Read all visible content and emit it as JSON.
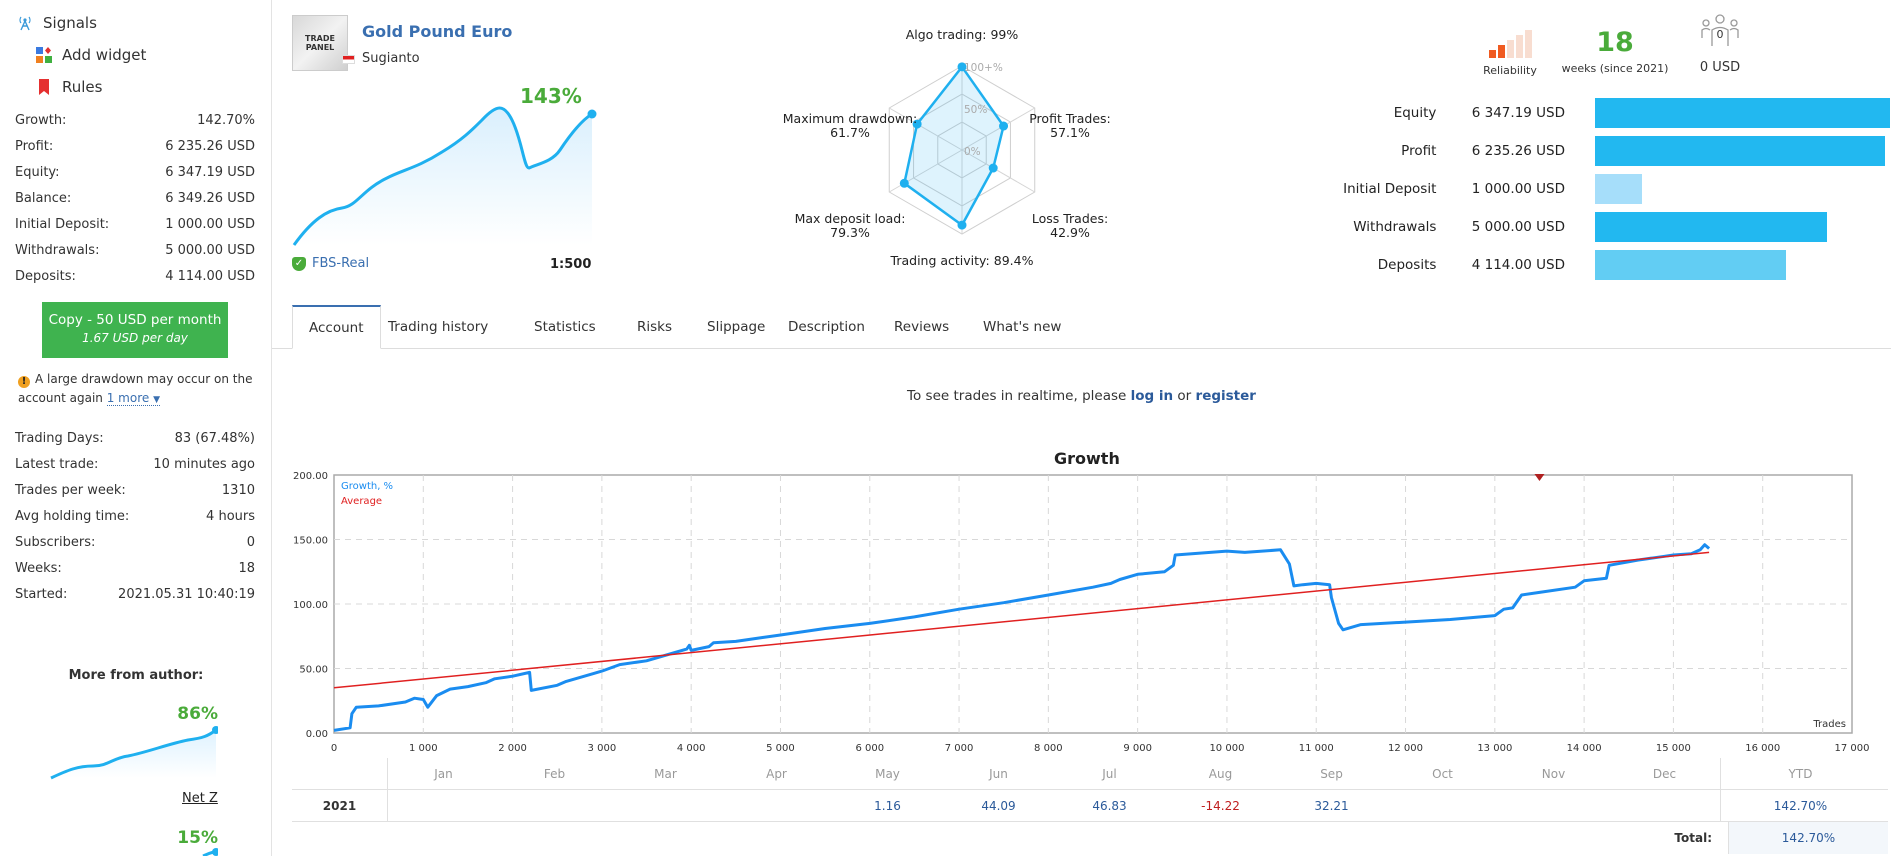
{
  "sidebar": {
    "nav": [
      {
        "label": "Signals",
        "icon": "antenna-icon"
      },
      {
        "label": "Add widget",
        "icon": "widget-icon"
      },
      {
        "label": "Rules",
        "icon": "bookmark-icon"
      }
    ],
    "stats": [
      {
        "label": "Growth:",
        "value": "142.70%"
      },
      {
        "label": "Profit:",
        "value": "6 235.26 USD"
      },
      {
        "label": "Equity:",
        "value": "6 347.19 USD"
      },
      {
        "label": "Balance:",
        "value": "6 349.26 USD"
      },
      {
        "label": "Initial Deposit:",
        "value": "1 000.00 USD"
      },
      {
        "label": "Withdrawals:",
        "value": "5 000.00 USD"
      },
      {
        "label": "Deposits:",
        "value": "4 114.00 USD"
      }
    ],
    "copy_button": {
      "line1": "Copy - 50 USD per month",
      "line2": "1.67 USD per day"
    },
    "warning": {
      "text": "A large drawdown may occur on the account again",
      "more": "1 more"
    },
    "stats2": [
      {
        "label": "Trading Days:",
        "value": "83 (67.48%)"
      },
      {
        "label": "Latest trade:",
        "value": "10 minutes ago"
      },
      {
        "label": "Trades per week:",
        "value": "1310"
      },
      {
        "label": "Avg holding time:",
        "value": "4 hours"
      },
      {
        "label": "Subscribers:",
        "value": "0"
      },
      {
        "label": "Weeks:",
        "value": "18"
      },
      {
        "label": "Started:",
        "value": "2021.05.31 10:40:19"
      }
    ],
    "more_from_author": "More from author:",
    "author_signals": [
      {
        "growth": "86%",
        "name": "Net Z"
      },
      {
        "growth": "15%",
        "name": ""
      }
    ]
  },
  "header": {
    "logo_text": "TRADE PANEL",
    "title": "Gold Pound Euro",
    "author": "Sugianto",
    "growth_pct": "143%",
    "broker": "FBS-Real",
    "leverage": "1:500"
  },
  "radar": {
    "scale_labels": [
      "100+%",
      "50%",
      "0%"
    ],
    "axes": [
      {
        "label": "Algo trading:",
        "value": "99%",
        "v": 99
      },
      {
        "label": "Profit Trades:",
        "value": "57.1%",
        "v": 57.1
      },
      {
        "label": "Loss Trades:",
        "value": "42.9%",
        "v": 42.9
      },
      {
        "label": "Trading activity:",
        "value": "89.4%",
        "v": 89.4
      },
      {
        "label": "Max deposit load:",
        "value": "79.3%",
        "v": 79.3
      },
      {
        "label": "Maximum drawdown:",
        "value": "61.7%",
        "v": 61.7
      }
    ]
  },
  "summary": {
    "reliability_label": "Reliability",
    "reliability_level": 2,
    "reliability_max": 5,
    "weeks": "18",
    "weeks_label": "weeks (since 2021)",
    "subscribers_count": "0",
    "subscribers_value": "0 USD"
  },
  "balance_bars": [
    {
      "label": "Equity",
      "value": "6 347.19 USD",
      "amount": 6347.19,
      "color": "#22b8f0"
    },
    {
      "label": "Profit",
      "value": "6 235.26 USD",
      "amount": 6235.26,
      "color": "#22b8f0"
    },
    {
      "label": "Initial Deposit",
      "value": "1 000.00 USD",
      "amount": 1000.0,
      "color": "#a6defa"
    },
    {
      "label": "Withdrawals",
      "value": "5 000.00 USD",
      "amount": 5000.0,
      "color": "#22b8f0"
    },
    {
      "label": "Deposits",
      "value": "4 114.00 USD",
      "amount": 4114.0,
      "color": "#62cdf3"
    }
  ],
  "tabs": [
    "Account",
    "Trading history",
    "Statistics",
    "Risks",
    "Slippage",
    "Description",
    "Reviews",
    "What's new"
  ],
  "active_tab": 0,
  "realtime": {
    "prefix": "To see trades in realtime, please ",
    "login": "log in",
    "or": " or ",
    "register": "register"
  },
  "chart_data": {
    "type": "line",
    "title": "Growth",
    "xlabel": "Trades",
    "ylabel": "",
    "xlim": [
      0,
      17000
    ],
    "ylim": [
      0,
      200
    ],
    "x_ticks": [
      "0",
      "1 000",
      "2 000",
      "3 000",
      "4 000",
      "5 000",
      "6 000",
      "7 000",
      "8 000",
      "9 000",
      "10 000",
      "11 000",
      "12 000",
      "13 000",
      "14 000",
      "15 000",
      "16 000",
      "17 000"
    ],
    "y_ticks": [
      "0.00",
      "50.00",
      "100.00",
      "150.00",
      "200.00"
    ],
    "grid": true,
    "legend": "top-left",
    "series": [
      {
        "name": "Growth, %",
        "color": "#1a8cf0",
        "x": [
          0,
          180,
          200,
          250,
          500,
          800,
          900,
          1000,
          1050,
          1150,
          1300,
          1500,
          1700,
          1800,
          2000,
          2190,
          2210,
          2500,
          2600,
          2900,
          3000,
          3200,
          3500,
          3800,
          3950,
          3980,
          4000,
          4200,
          4250,
          4500,
          4800,
          5000,
          5500,
          6000,
          6500,
          7000,
          7500,
          8000,
          8500,
          8700,
          8800,
          9000,
          9300,
          9400,
          9420,
          10000,
          10200,
          10600,
          10700,
          10750,
          10850,
          11000,
          11150,
          11170,
          11250,
          11300,
          11500,
          12000,
          12500,
          13000,
          13100,
          13200,
          13300,
          13500,
          13900,
          14000,
          14250,
          14280,
          14600,
          14900,
          15000,
          15200,
          15300,
          15350,
          15400
        ],
        "y": [
          2,
          4,
          15,
          20,
          21,
          24,
          27,
          26,
          20,
          29,
          34,
          36,
          39,
          42,
          44,
          47,
          33,
          37,
          40,
          46,
          48,
          53,
          56,
          62,
          65,
          68,
          64,
          67,
          70,
          71,
          74,
          76,
          81,
          85,
          90,
          96,
          101,
          107,
          113,
          116,
          119,
          123,
          125,
          130,
          138,
          141,
          140,
          142,
          131,
          114,
          115,
          116,
          115,
          105,
          85,
          80,
          84,
          86,
          88,
          91,
          96,
          97,
          107,
          109,
          113,
          118,
          120,
          130,
          134,
          137,
          138,
          139,
          142,
          146,
          143
        ]
      },
      {
        "name": "Average",
        "color": "#e02020",
        "x": [
          0,
          15400
        ],
        "y": [
          35,
          140
        ]
      }
    ]
  },
  "monthly": {
    "months": [
      "Jan",
      "Feb",
      "Mar",
      "Apr",
      "May",
      "Jun",
      "Jul",
      "Aug",
      "Sep",
      "Oct",
      "Nov",
      "Dec"
    ],
    "ytd_label": "YTD",
    "rows": [
      {
        "year": "2021",
        "values": [
          "",
          "",
          "",
          "",
          "1.16",
          "44.09",
          "46.83",
          "-14.22",
          "32.21",
          "",
          "",
          ""
        ],
        "ytd": "142.70%"
      }
    ],
    "total_label": "Total:",
    "total_value": "142.70%"
  }
}
